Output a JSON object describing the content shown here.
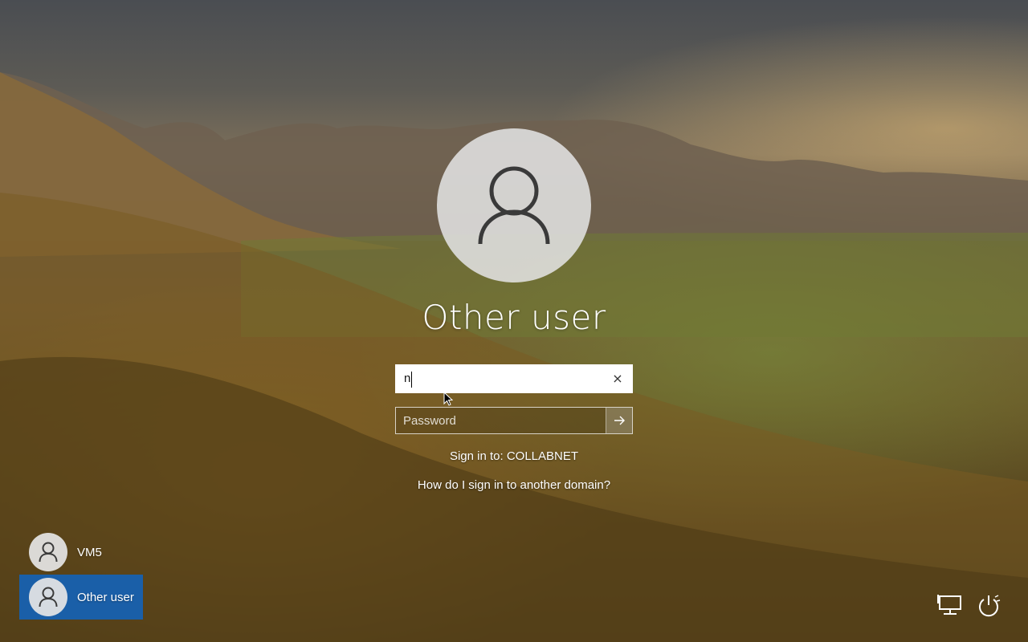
{
  "screen": {
    "type": "windows-lock-screen",
    "colors": {
      "selected_tile": "#1a5fa8",
      "avatar_bg": "#e1e1e1",
      "text": "#ffffff"
    }
  },
  "profile": {
    "avatar_icon": "person-icon",
    "title": "Other user"
  },
  "form": {
    "username_value": "n",
    "clear_icon": "×",
    "password_placeholder": "Password",
    "submit_icon": "arrow-right-icon",
    "sign_in_to": "Sign in to: COLLABNET",
    "domain_help": "How do I sign in to another domain?"
  },
  "user_list": [
    {
      "name": "VM5",
      "selected": false
    },
    {
      "name": "Other user",
      "selected": true
    }
  ],
  "corner": {
    "network_icon": "network-icon",
    "power_icon": "power-icon"
  }
}
